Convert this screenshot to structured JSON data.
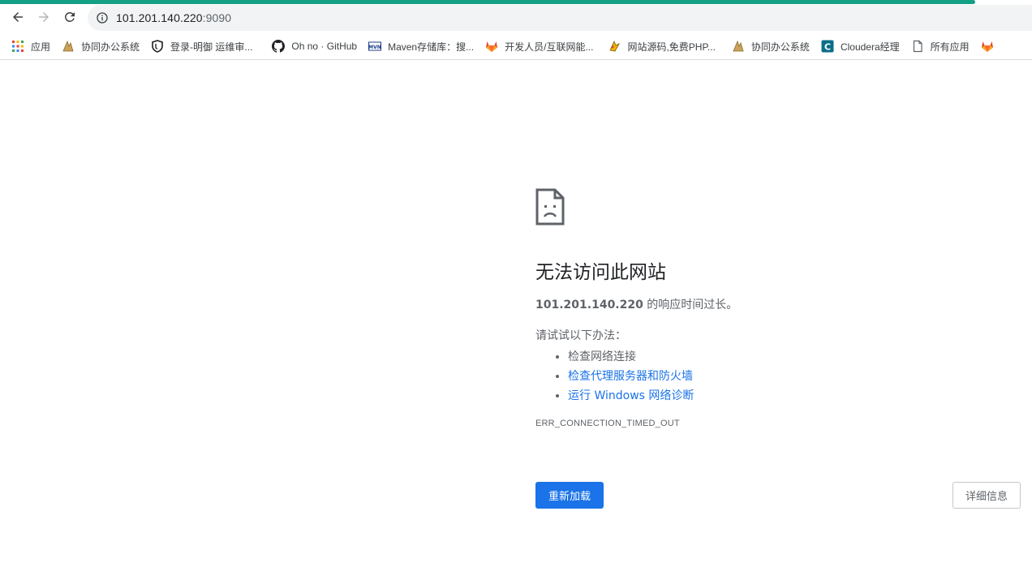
{
  "browser": {
    "url_host": "101.201.140.220",
    "url_port": ":9090",
    "progress_color": "#14a085"
  },
  "bookmarks": [
    {
      "label": "应用",
      "icon": "apps-grid-icon"
    },
    {
      "label": "协同办公系统",
      "icon": "oa-logo-icon"
    },
    {
      "label": "登录-明御 运维审...",
      "icon": "shield-icon"
    },
    {
      "label": "Oh no · GitHub",
      "icon": "github-icon"
    },
    {
      "label": "Maven存储库：搜...",
      "icon": "maven-icon"
    },
    {
      "label": "开发人员/互联网能...",
      "icon": "gitlab-icon"
    },
    {
      "label": "网站源码,免费PHP...",
      "icon": "site-logo-icon"
    },
    {
      "label": "协同办公系统",
      "icon": "oa-logo-icon"
    },
    {
      "label": "Cloudera经理",
      "icon": "cloudera-icon"
    },
    {
      "label": "所有应用",
      "icon": "page-icon"
    },
    {
      "label": "",
      "icon": "gitlab-icon"
    }
  ],
  "error": {
    "title": "无法访问此网站",
    "host": "101.201.140.220",
    "desc_suffix": " 的响应时间过长。",
    "try_label": "请试试以下办法：",
    "suggestions": [
      {
        "text": "检查网络连接",
        "link": false
      },
      {
        "text": "检查代理服务器和防火墙",
        "link": true
      },
      {
        "text": "运行 Windows 网络诊断",
        "link": true
      }
    ],
    "code": "ERR_CONNECTION_TIMED_OUT",
    "reload_label": "重新加载",
    "details_label": "详细信息"
  },
  "colors": {
    "link": "#1a73e8",
    "primary_button": "#1a73e8"
  }
}
